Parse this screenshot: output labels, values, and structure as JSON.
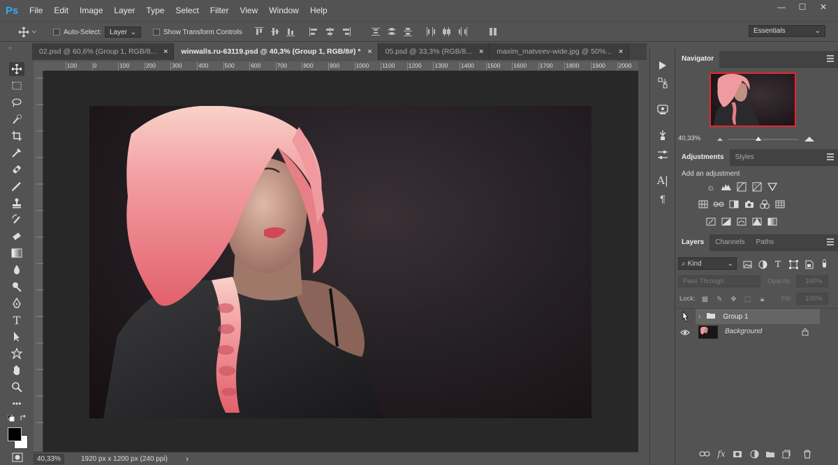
{
  "app": {
    "logo": "Ps"
  },
  "menu": [
    "File",
    "Edit",
    "Image",
    "Layer",
    "Type",
    "Select",
    "Filter",
    "View",
    "Window",
    "Help"
  ],
  "window_controls": {
    "minimize": "—",
    "maximize": "☐",
    "close": "✕"
  },
  "options_bar": {
    "auto_select_label": "Auto-Select:",
    "auto_select_value": "Layer",
    "show_transform_label": "Show Transform Controls"
  },
  "workspace": {
    "value": "Essentials"
  },
  "tabs": [
    {
      "label": "02.psd @ 60,6% (Group 1, RGB/8..."
    },
    {
      "label": "winwalls.ru-63119.psd @ 40,3% (Group 1, RGB/8#) *"
    },
    {
      "label": "05.psd @ 33,3% (RGB/8..."
    },
    {
      "label": "maxim_matveev-wide.jpg @ 50%..."
    }
  ],
  "ruler_ticks": [
    "100",
    "0",
    "100",
    "200",
    "300",
    "400",
    "500",
    "600",
    "700",
    "800",
    "900",
    "1000",
    "1100",
    "1200",
    "1300",
    "1400",
    "1500",
    "1600",
    "1700",
    "1800",
    "1900",
    "2000"
  ],
  "status": {
    "zoom": "40,33%",
    "doc_info": "1920 px x 1200 px (240 ppi)",
    "arrow": "›"
  },
  "navigator": {
    "title": "Navigator",
    "zoom": "40,33%"
  },
  "adjustments": {
    "tab1": "Adjustments",
    "tab2": "Styles",
    "prompt": "Add an adjustment"
  },
  "layers_panel": {
    "tabs": [
      "Layers",
      "Channels",
      "Paths"
    ],
    "filter_kind": "Kind",
    "blend_mode": "Pass Through",
    "opacity_label": "Opacity:",
    "opacity_value": "100%",
    "lock_label": "Lock:",
    "fill_label": "Fill:",
    "fill_value": "100%",
    "layers": [
      {
        "name": "Group 1",
        "type": "group",
        "selected": true
      },
      {
        "name": "Background",
        "type": "image",
        "locked": true
      }
    ],
    "bottom_icons": [
      "link-icon",
      "fx-icon",
      "mask-icon",
      "adjustment-icon",
      "folder-icon",
      "new-layer-icon",
      "trash-icon"
    ],
    "fx_label": "fx"
  },
  "colors": {
    "accent": "#31a8ff",
    "nav_frame": "#e8252b",
    "hair": "#f08a8f"
  }
}
